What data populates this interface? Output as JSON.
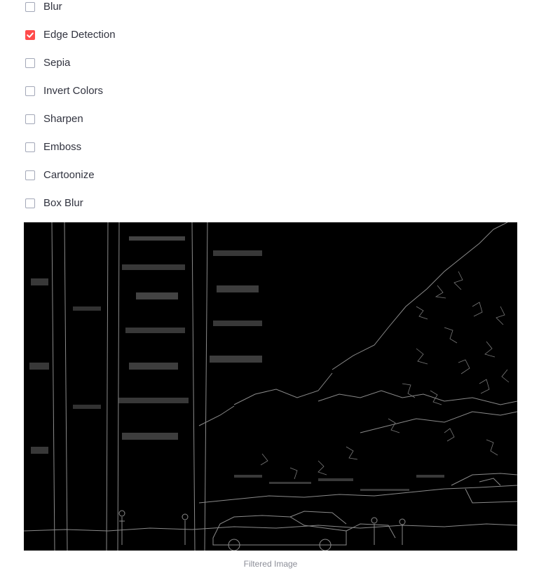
{
  "filters": [
    {
      "label": "Blur",
      "checked": false
    },
    {
      "label": "Edge Detection",
      "checked": true
    },
    {
      "label": "Sepia",
      "checked": false
    },
    {
      "label": "Invert Colors",
      "checked": false
    },
    {
      "label": "Sharpen",
      "checked": false
    },
    {
      "label": "Emboss",
      "checked": false
    },
    {
      "label": "Cartoonize",
      "checked": false
    },
    {
      "label": "Box Blur",
      "checked": false
    }
  ],
  "image": {
    "caption": "Filtered Image",
    "description_icon": "edge-detected-image"
  },
  "colors": {
    "accent": "#ff4b4b",
    "edge_line": "#8a8a8a",
    "image_background": "#000000"
  }
}
